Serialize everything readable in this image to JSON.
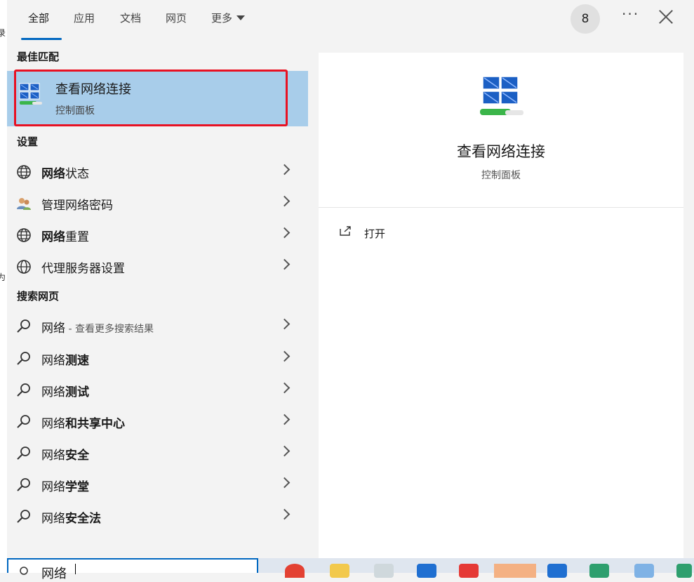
{
  "tabs": [
    "全部",
    "应用",
    "文档",
    "网页",
    "更多"
  ],
  "avatar_text": "8",
  "more_text": "···",
  "bg_edge": [
    "录",
    "为"
  ],
  "sections": {
    "best": "最佳匹配",
    "settings": "设置",
    "web": "搜索网页"
  },
  "best_match": {
    "title": "查看网络连接",
    "subtitle": "控制面板",
    "icon": "network-connections-icon"
  },
  "settings_items": [
    {
      "bold": "网络",
      "rest": "状态",
      "icon": "globe-icon"
    },
    {
      "bold": "",
      "rest": "管理网络密码",
      "icon": "users-icon"
    },
    {
      "bold": "网络",
      "rest": "重置",
      "icon": "globe-icon"
    },
    {
      "bold": "",
      "rest": "代理服务器设置",
      "icon": "globe-icon"
    }
  ],
  "web_items": [
    {
      "prefix": "网络",
      "bold": "",
      "hint": " - 查看更多搜索结果"
    },
    {
      "prefix": "网络",
      "bold": "测速",
      "hint": ""
    },
    {
      "prefix": "网络",
      "bold": "测试",
      "hint": ""
    },
    {
      "prefix": "网络",
      "bold": "和共享中心",
      "hint": ""
    },
    {
      "prefix": "网络",
      "bold": "安全",
      "hint": ""
    },
    {
      "prefix": "网络",
      "bold": "学堂",
      "hint": ""
    },
    {
      "prefix": "网络",
      "bold": "安全法",
      "hint": ""
    }
  ],
  "detail": {
    "title": "查看网络连接",
    "subtitle": "控制面板",
    "open_label": "打开"
  },
  "search": {
    "value": "网络"
  },
  "colors": {
    "accent": "#0067c0",
    "selection": "#a8cdea",
    "highlight_border": "#e81123"
  }
}
